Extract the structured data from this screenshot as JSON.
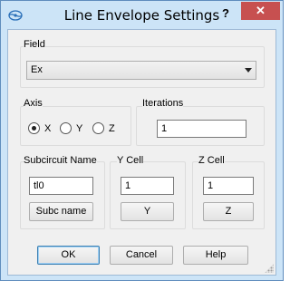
{
  "window": {
    "title": "Line Envelope Settings",
    "help_label": "?",
    "close_label": "✕"
  },
  "field": {
    "label": "Field",
    "selected": "Ex"
  },
  "axis": {
    "label": "Axis",
    "options": [
      "X",
      "Y",
      "Z"
    ],
    "selected": "X"
  },
  "iterations": {
    "label": "Iterations",
    "value": "1"
  },
  "subcircuit": {
    "label": "Subcircuit Name",
    "value": "tl0",
    "button": "Subc name"
  },
  "ycell": {
    "label": "Y Cell",
    "value": "1",
    "button": "Y"
  },
  "zcell": {
    "label": "Z Cell",
    "value": "1",
    "button": "Z"
  },
  "buttons": {
    "ok": "OK",
    "cancel": "Cancel",
    "help": "Help"
  }
}
